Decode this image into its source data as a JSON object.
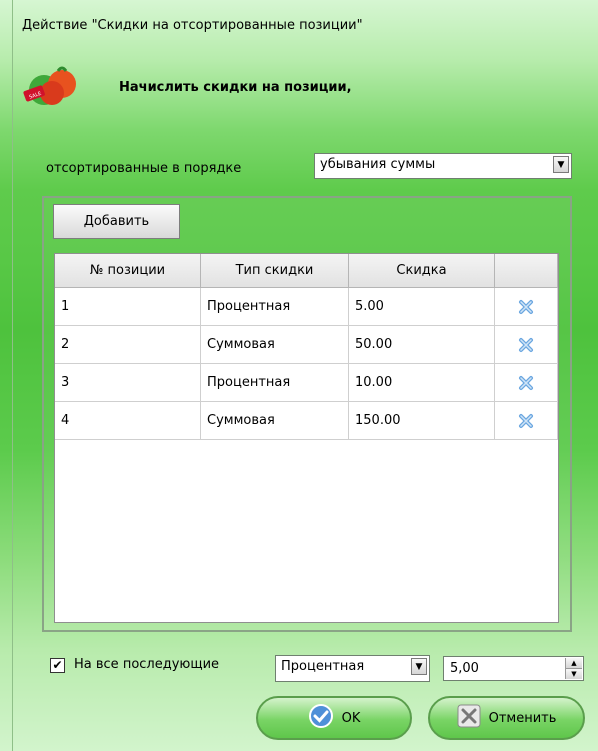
{
  "dialog": {
    "title": "Действие \"Скидки на отсортированные позиции\"",
    "heading": "Начислить скидки на позиции,"
  },
  "order": {
    "label": "отсортированные в порядке",
    "selected": "убывания суммы"
  },
  "toolbar": {
    "add_label": "Добавить"
  },
  "table": {
    "headers": [
      "№ позиции",
      "Тип скидки",
      "Скидка",
      ""
    ],
    "rows": [
      {
        "pos": "1",
        "type": "Процентная",
        "discount": "5.00"
      },
      {
        "pos": "2",
        "type": "Суммовая",
        "discount": "50.00"
      },
      {
        "pos": "3",
        "type": "Процентная",
        "discount": "10.00"
      },
      {
        "pos": "4",
        "type": "Суммовая",
        "discount": "150.00"
      }
    ]
  },
  "footer": {
    "checkbox_label": "На все последующие",
    "checkbox_checked": true,
    "type_selected": "Процентная",
    "amount": "5,00",
    "ok_label": "OK",
    "cancel_label": "Отменить"
  },
  "icons": {
    "logo": "tomatoes-sale-icon",
    "delete": "delete-x-icon",
    "ok": "checkmark-circle-icon",
    "cancel": "cross-square-icon"
  },
  "colors": {
    "accent_green": "#58c846",
    "delete_blue": "#6aa6e0"
  }
}
